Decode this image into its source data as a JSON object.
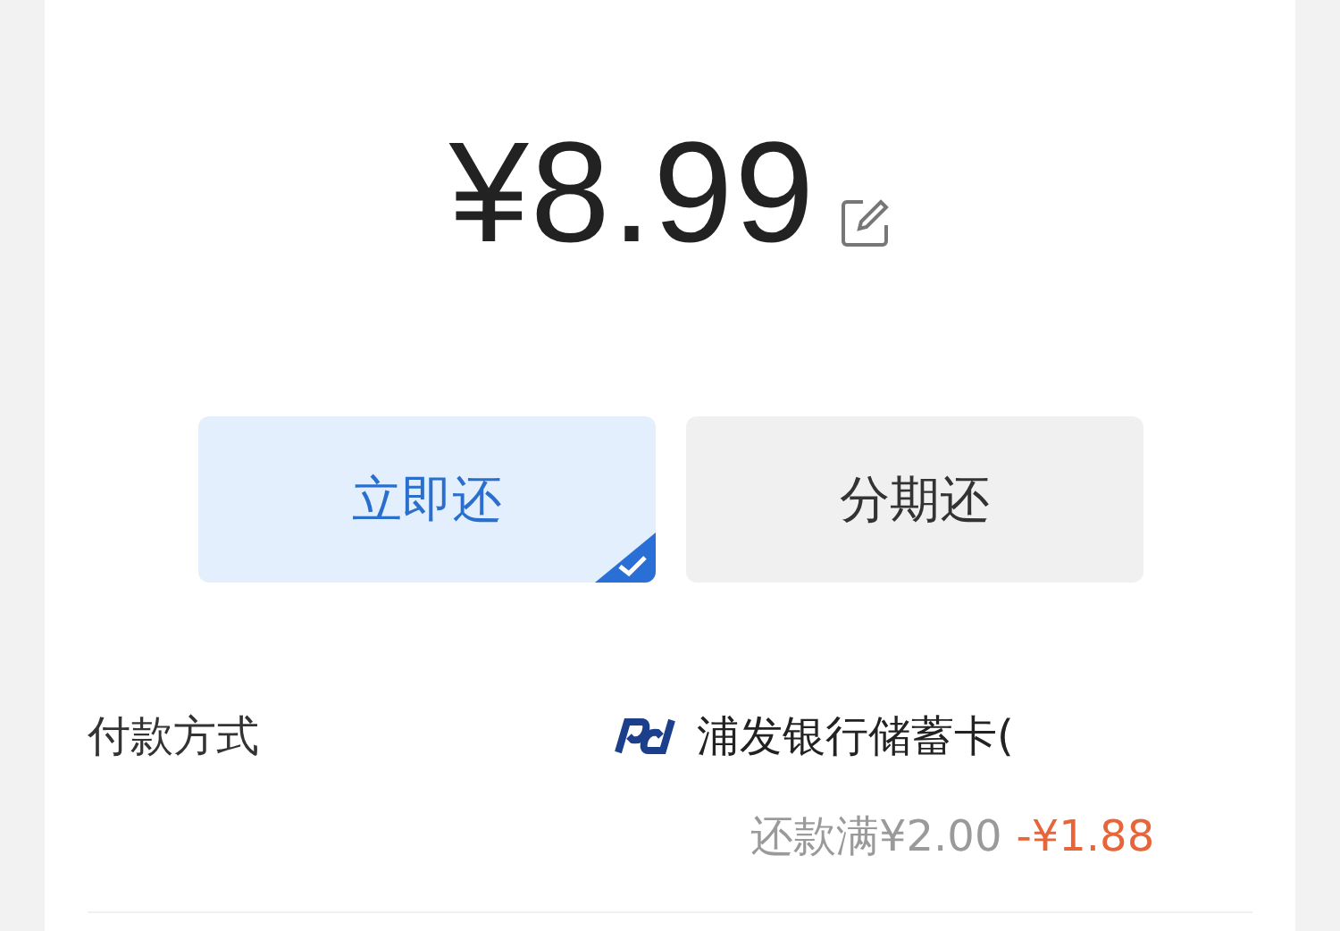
{
  "amount": "¥8.99",
  "options": [
    {
      "label": "立即还",
      "selected": true
    },
    {
      "label": "分期还",
      "selected": false
    }
  ],
  "payment": {
    "label": "付款方式",
    "card": "浦发银行储蓄卡(",
    "condition": "还款满¥2.00",
    "discount": "-¥1.88"
  }
}
